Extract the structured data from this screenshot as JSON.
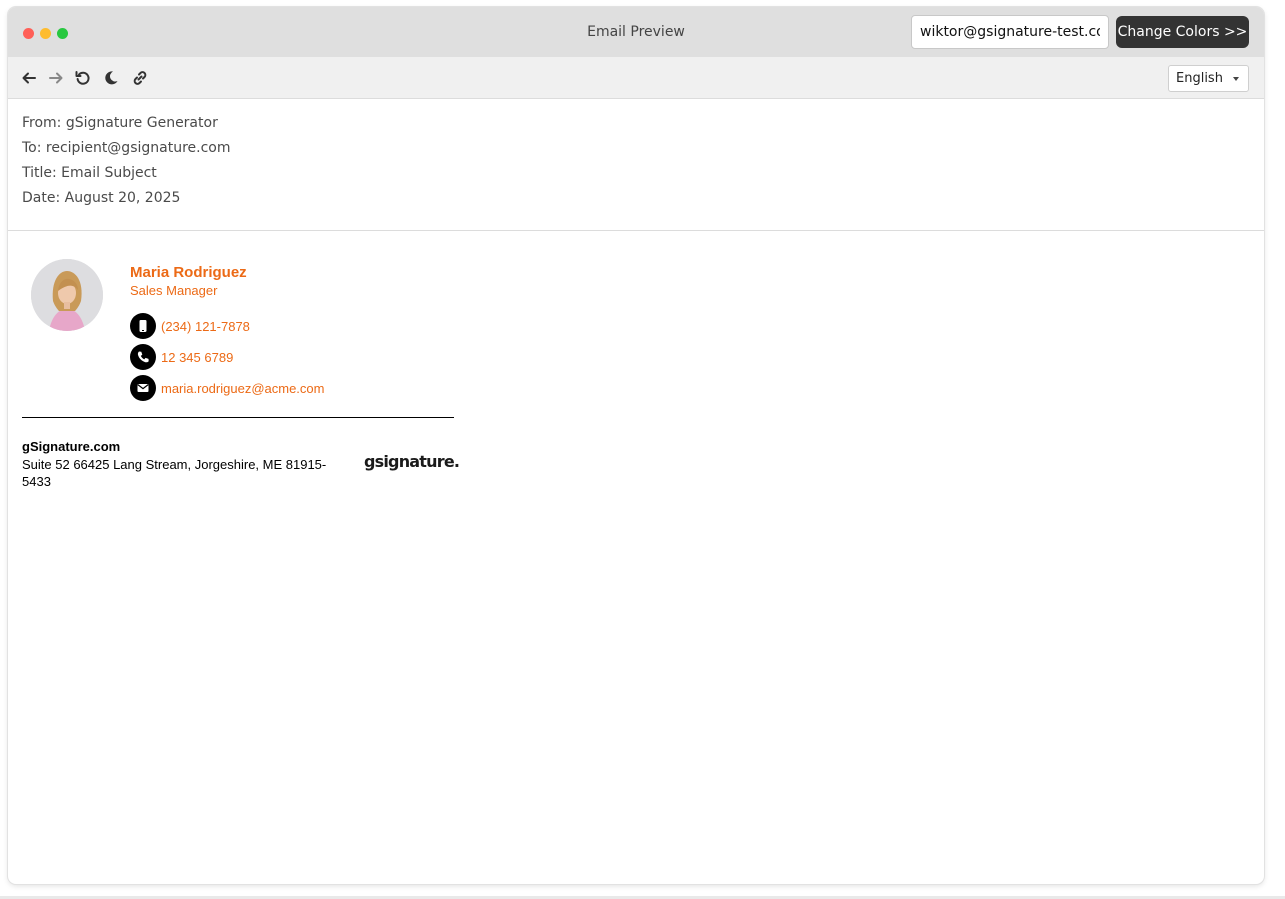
{
  "window": {
    "title": "Email Preview",
    "sender_email_value": "wiktor@gsignature-test.com",
    "change_colors_label": "Change Colors >>"
  },
  "toolbar": {
    "icons": [
      "arrow-left-icon",
      "arrow-right-icon",
      "reload-icon",
      "moon-icon",
      "link-icon"
    ],
    "language": "English"
  },
  "email_headers": {
    "from": "From: gSignature Generator",
    "to": "To: recipient@gsignature.com",
    "title": "Title: Email Subject",
    "date": "Date: August 20, 2025"
  },
  "signature": {
    "name": "Maria Rodriguez",
    "role": "Sales Manager",
    "mobile": "(234) 121-7878",
    "phone": "12 345 6789",
    "email": "maria.rodriguez@acme.com",
    "company": "gSignature.com",
    "address": "Suite 52 66425 Lang Stream, Jorgeshire, ME 81915-5433",
    "logo_text": "gsignature."
  },
  "colors": {
    "accent": "#ec6a16",
    "button_dark": "#333333",
    "titlebar": "#dfdfdf"
  }
}
